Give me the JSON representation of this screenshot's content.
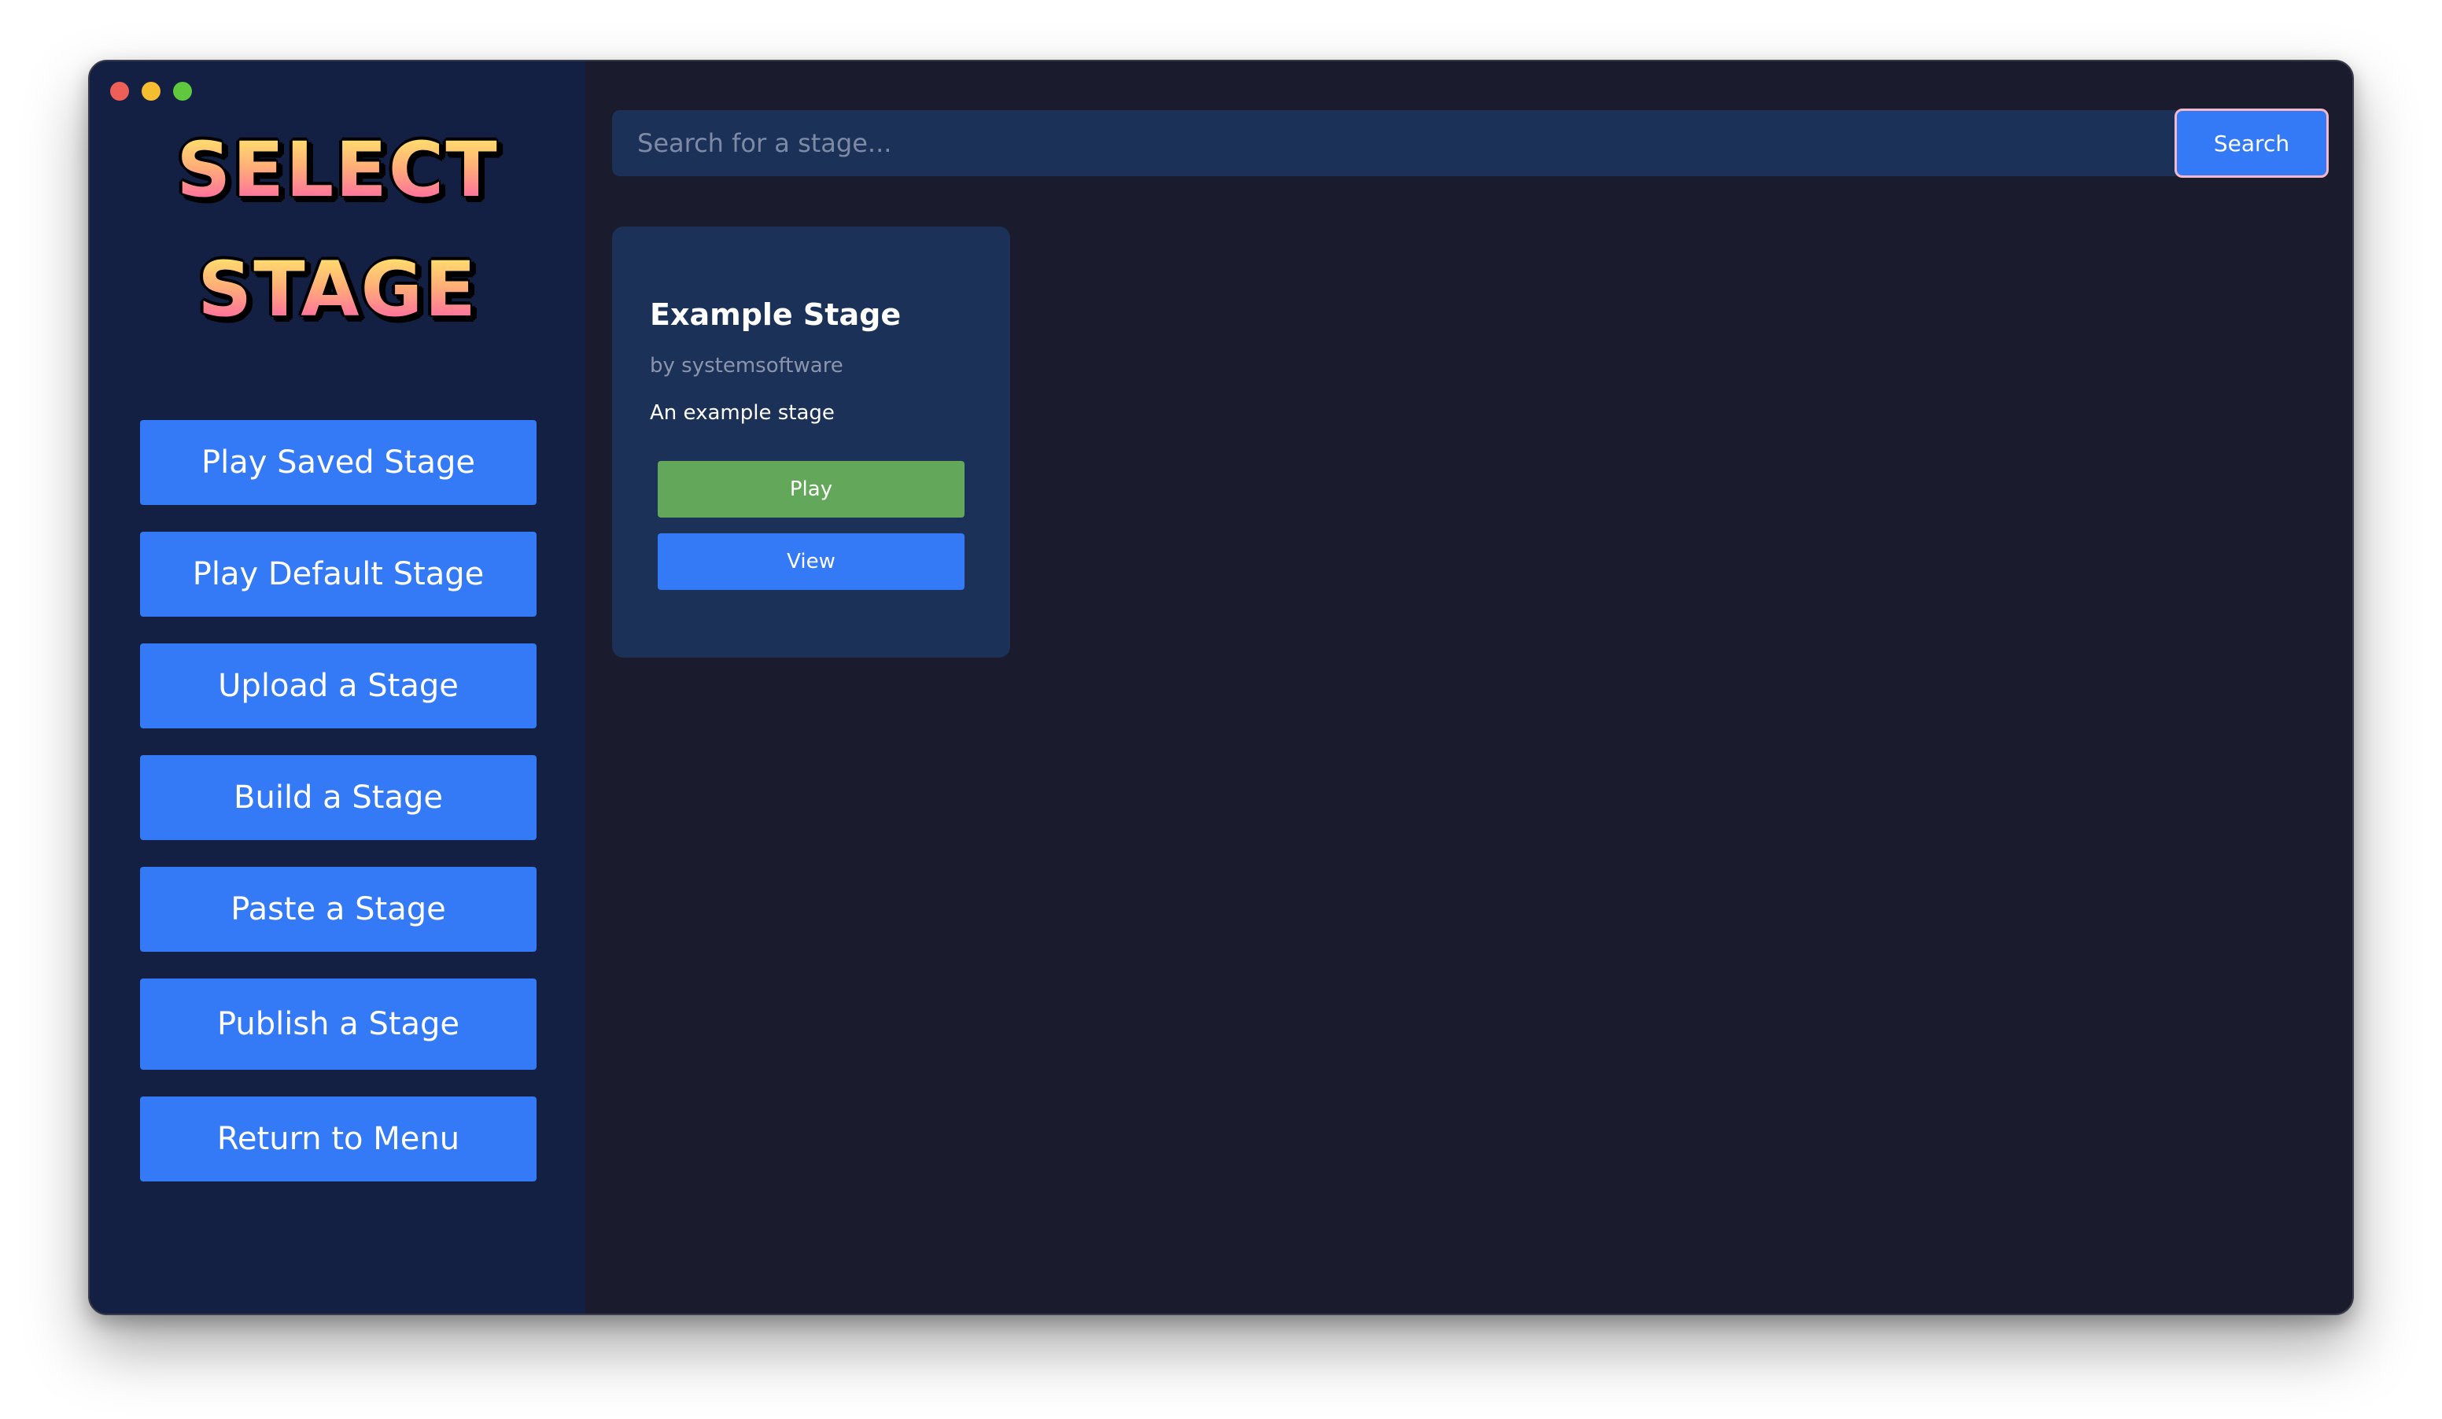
{
  "window": {
    "controls": [
      "close",
      "minimize",
      "maximize"
    ]
  },
  "sidebar": {
    "logo": {
      "line1": "SELECT",
      "line2": "STAGE"
    },
    "items": [
      {
        "label": "Play Saved Stage"
      },
      {
        "label": "Play Default Stage"
      },
      {
        "label": "Upload a Stage"
      },
      {
        "label": "Build a Stage"
      },
      {
        "label": "Paste a Stage"
      },
      {
        "label": "Publish a Stage"
      },
      {
        "label": "Return to Menu"
      }
    ]
  },
  "search": {
    "placeholder": "Search for a stage...",
    "value": "",
    "button_label": "Search"
  },
  "stages": [
    {
      "title": "Example Stage",
      "author": "by systemsoftware",
      "description": "An example stage",
      "play_label": "Play",
      "view_label": "View"
    }
  ],
  "colors": {
    "accent_blue": "#3479f6",
    "play_green": "#63a75a",
    "sidebar_bg": "#142043",
    "main_bg": "#1a1b2c",
    "card_bg": "#1c3157"
  }
}
